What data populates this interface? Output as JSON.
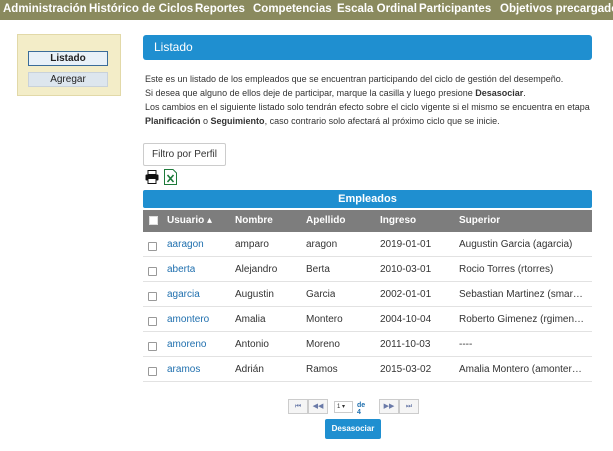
{
  "nav": {
    "items": [
      {
        "label": "Administración"
      },
      {
        "label": "Histórico de Ciclos"
      },
      {
        "label": "Reportes"
      },
      {
        "label": "Competencias"
      },
      {
        "label": "Escala Ordinal"
      },
      {
        "label": "Participantes"
      },
      {
        "label": "Objetivos precargados"
      }
    ],
    "active": "Participantes"
  },
  "sidebar": {
    "listado": "Listado",
    "agregar": "Agregar"
  },
  "main": {
    "title": "Listado",
    "desc_line1": "Este es un listado de los empleados que se encuentran participando del ciclo de gestión del desempeño.",
    "desc_line2a": "Si desea que alguno de ellos deje de participar, marque la casilla y luego presione ",
    "desc_line2b": "Desasociar",
    "desc_line2c": ".",
    "desc_line3": "Los cambios en el siguiente listado solo tendrán efecto sobre el ciclo vigente si el mismo se encuentra en etapa",
    "desc_line4a": "Planificación",
    "desc_line4b": " o ",
    "desc_line4c": "Seguimiento",
    "desc_line4d": ", caso contrario solo afectará al próximo ciclo que se inicie.",
    "filter_label": "Filtro por Perfil"
  },
  "table": {
    "title": "Empleados",
    "headers": {
      "usuario": "Usuario ▴",
      "nombre": "Nombre",
      "apellido": "Apellido",
      "ingreso": "Ingreso",
      "superior": "Superior"
    },
    "rows": [
      {
        "usuario": "aaragon",
        "nombre": "amparo",
        "apellido": "aragon",
        "ingreso": "2019-01-01",
        "superior": "Augustin Garcia (agarcia)"
      },
      {
        "usuario": "aberta",
        "nombre": "Alejandro",
        "apellido": "Berta",
        "ingreso": "2010-03-01",
        "superior": "Rocio Torres (rtorres)"
      },
      {
        "usuario": "agarcia",
        "nombre": "Augustin",
        "apellido": "Garcia",
        "ingreso": "2002-01-01",
        "superior": "Sebastian Martinez (smar…"
      },
      {
        "usuario": "amontero",
        "nombre": "Amalia",
        "apellido": "Montero",
        "ingreso": "2004-10-04",
        "superior": "Roberto Gimenez (rgimen…"
      },
      {
        "usuario": "amoreno",
        "nombre": "Antonio",
        "apellido": "Moreno",
        "ingreso": "2011-10-03",
        "superior": "----"
      },
      {
        "usuario": "aramos",
        "nombre": "Adrián",
        "apellido": "Ramos",
        "ingreso": "2015-03-02",
        "superior": "Amalia Montero (amonter…"
      }
    ]
  },
  "pager": {
    "first": "⏮",
    "prev": "◀◀",
    "page": "1",
    "of": "de 4",
    "next": "▶▶",
    "last": "⏭"
  },
  "actions": {
    "desasociar": "Desasociar"
  },
  "colors": {
    "nav_bg": "#8a8a5e",
    "accent": "#1f8fd0",
    "link": "#1f6fae",
    "header_gray": "#7d7d7d"
  }
}
